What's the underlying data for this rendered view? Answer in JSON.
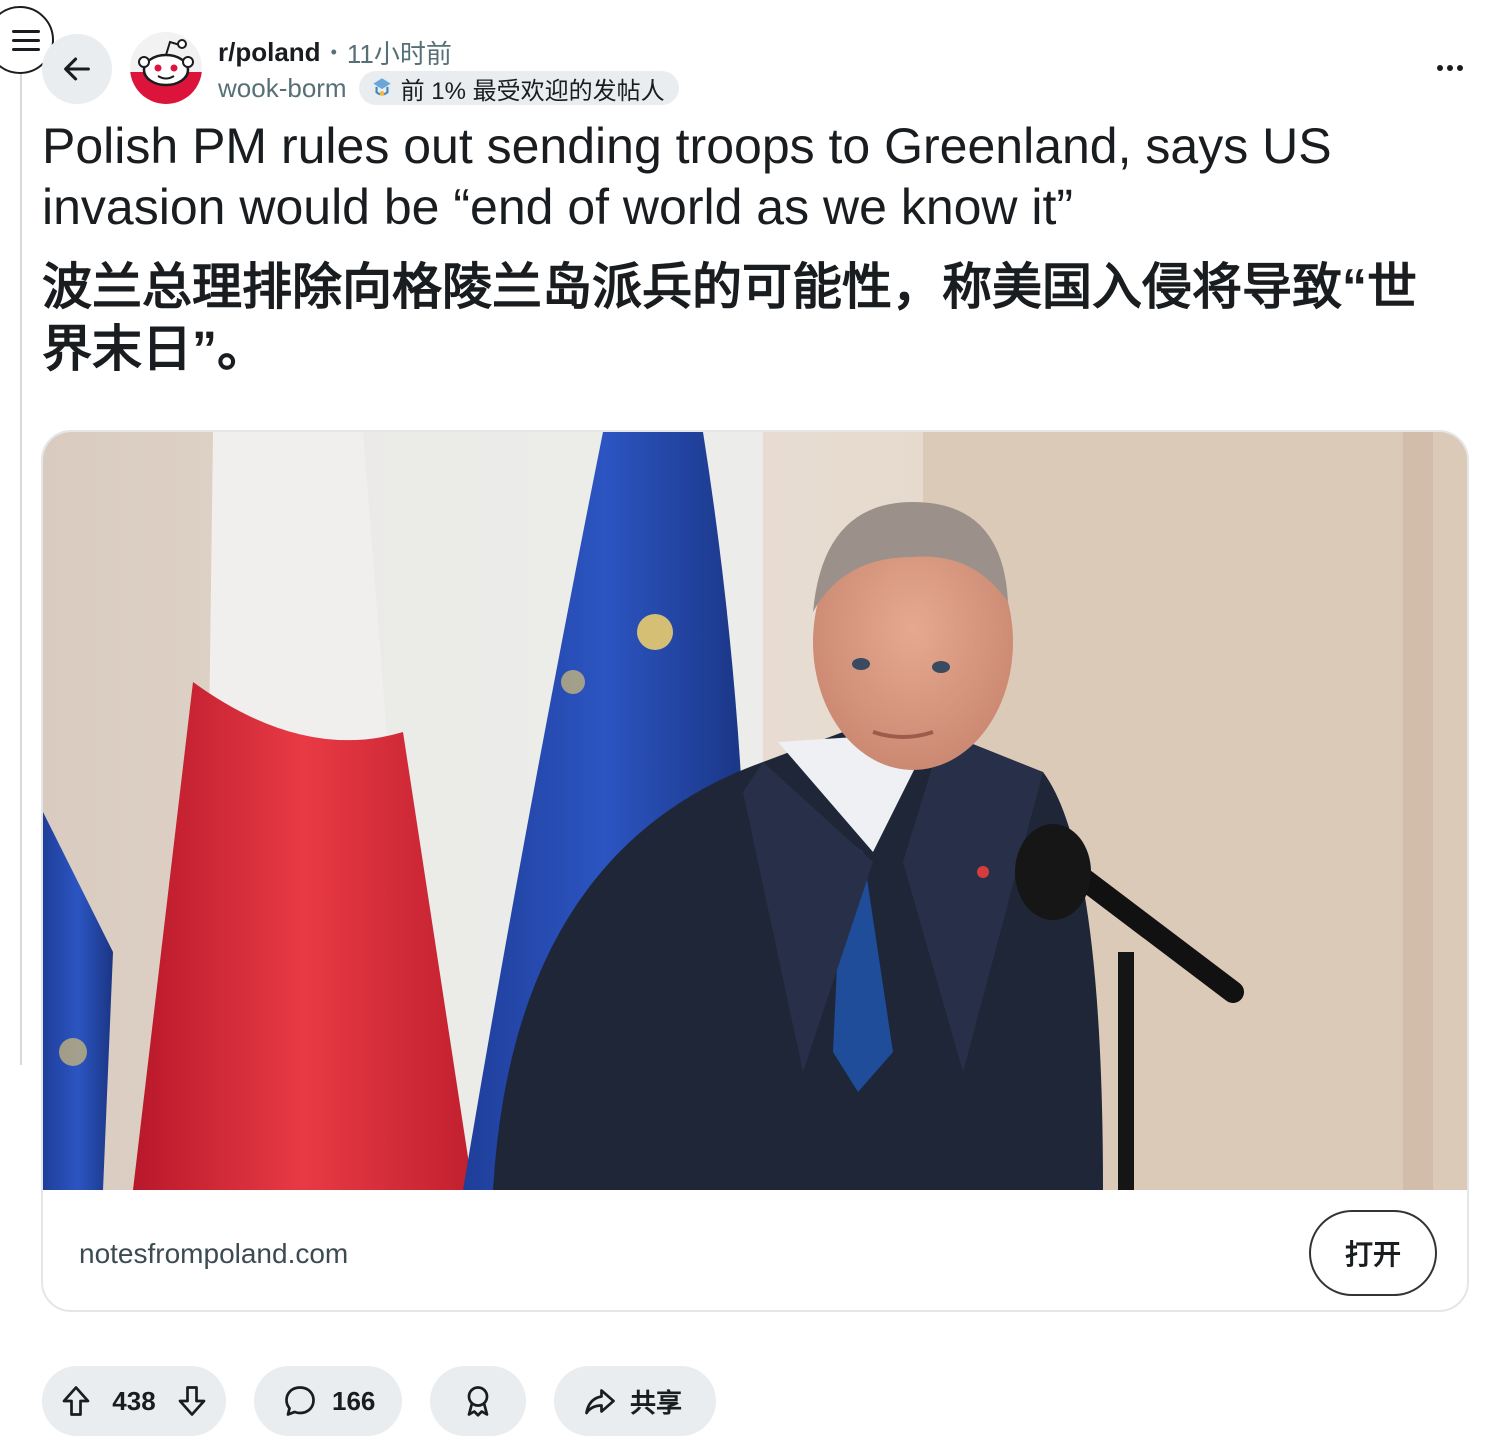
{
  "post": {
    "subreddit": "r/poland",
    "separator": "•",
    "time": "11小时前",
    "author": "wook-borm",
    "flair": "前 1% 最受欢迎的发帖人",
    "title": "Polish PM rules out sending troops to Greenland, says US invasion would be “end of world as we know it”",
    "title_translation": "波兰总理排除向格陵兰岛派兵的可能性，称美国入侵将导致“世界末日”。"
  },
  "link_card": {
    "domain": "notesfrompoland.com",
    "open_label": "打开"
  },
  "actions": {
    "score": "438",
    "comments": "166",
    "share_label": "共享"
  },
  "colors": {
    "accent_red": "#dc143c",
    "pill_bg": "#eaedef",
    "text": "#1a1d20",
    "muted": "#576f76"
  },
  "icons": [
    "menu-icon",
    "back-arrow-icon",
    "subreddit-avatar",
    "flair-icon",
    "more-icon",
    "upvote-icon",
    "downvote-icon",
    "comment-icon",
    "award-icon",
    "share-icon"
  ]
}
